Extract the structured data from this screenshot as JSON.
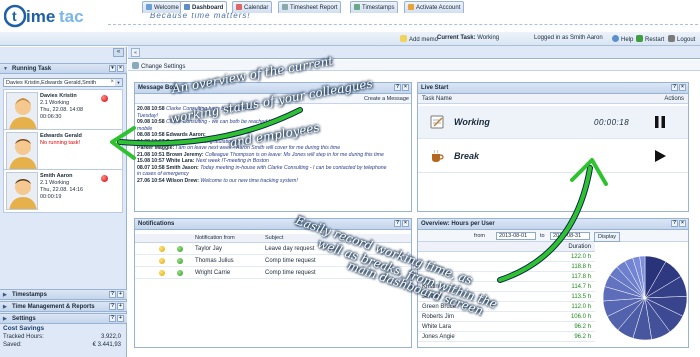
{
  "brand": {
    "logo_text": "timetac",
    "tagline": "Because time matters!",
    "accent_color": "#1f5fa8",
    "running_dot_color": "#d40000"
  },
  "toolbar": {
    "add_memo": "Add memo",
    "current_task_label": "Current Task:",
    "current_task_value": "Working",
    "logged_in": "Logged in as Smith Aaron",
    "help": "Help",
    "restart": "Restart",
    "logout": "Logout"
  },
  "left_panel": {
    "running_task_title": "Running Task",
    "filter_value": "Davies Kristin,Edwards Gerald,Smith",
    "users": [
      {
        "name": "Davies Kristin",
        "task": "2.1 Working",
        "date": "Thu, 22.08. 14:08",
        "duration": "00:06:30",
        "running": true
      },
      {
        "name": "Edwards Gerald",
        "task": "No running task!",
        "date": "",
        "duration": "",
        "running": false
      },
      {
        "name": "Smith Aaron",
        "task": "2.1 Working",
        "date": "Thu, 22.08. 14:16",
        "duration": "00:00:19",
        "running": true
      }
    ],
    "sections": [
      "Timestamps",
      "Time Management & Reports",
      "Settings"
    ],
    "cost_savings": {
      "title": "Cost Savings",
      "tracked_label": "Tracked Hours:",
      "tracked_value": "3.922,0",
      "saved_label": "Saved:",
      "saved_value": "€ 3.441,93"
    }
  },
  "tabs": [
    "Welcome",
    "Dashboard",
    "Calendar",
    "Timesheet Report",
    "Timestamps",
    "Activate Account"
  ],
  "active_tab": "Dashboard",
  "change_settings": "Change Settings",
  "message_box": {
    "title": "Message Box",
    "create_label": "Create a Message",
    "messages": [
      {
        "date": "20.08 10:58",
        "author": "",
        "text": "Clarke Consulting have been moved to"
      },
      {
        "date": "",
        "author": "",
        "text": "Tuesday!"
      },
      {
        "date": "09.08 10:58",
        "author": "",
        "text": "Clarke Consulting - we can both be reached by"
      },
      {
        "date": "",
        "author": "",
        "text": "mobile"
      },
      {
        "date": "08.08 10:58",
        "author": "Edwards Aaron:",
        "text": ""
      },
      {
        "date": "04.08 10:57",
        "author": "Smith Jason:",
        "text": "Congratulations!"
      },
      {
        "date": "",
        "author": "Parker Maggie:",
        "text": "I am on leave next week - Aaron Smith will cover for me during this time"
      },
      {
        "date": "",
        "author": "",
        "text": "Colleague Thompson is on leave: Ms Jones will step in for me during this time"
      },
      {
        "date": "21.08 10:51",
        "author": "Brown Jeremy:",
        "text": "Colleague Thompson is on leave: Ms Jones will step in for me during this time"
      },
      {
        "date": "15.08 10:57",
        "author": "White Lara:",
        "text": "Next week IT-meeting in Boston"
      },
      {
        "date": "08.07 10:58",
        "author": "Smith Jason:",
        "text": "Today meeting in-house with Clarke Consulting - I can be contacted by telephone"
      },
      {
        "date": "",
        "author": "",
        "text": "in cases of emergency"
      },
      {
        "date": "27.06 10:54",
        "author": "Wilson Drew:",
        "text": "Welcome to our new time tracking system!"
      }
    ]
  },
  "live_start": {
    "title": "Live Start",
    "col_task": "Task Name",
    "col_actions": "Actions",
    "rows": [
      {
        "label": "Working",
        "time": "00:00:18",
        "action": "pause"
      },
      {
        "label": "Break",
        "time": "",
        "action": "play"
      }
    ]
  },
  "notifications": {
    "title": "Notifications",
    "col_from": "Notification from",
    "col_subject": "Subject",
    "rows": [
      {
        "from": "Taylor Jay",
        "subject": "Leave day request"
      },
      {
        "from": "Thomas Julius",
        "subject": "Comp time request"
      },
      {
        "from": "Wright Carrie",
        "subject": "Comp time request"
      }
    ]
  },
  "overview": {
    "title": "Overview: Hours per User",
    "from_label": "from",
    "from_date": "2013-08-01",
    "to_label": "to",
    "to_date": "2013-08-31",
    "display_label": "Display",
    "col_duration": "Duration",
    "rows": [
      {
        "name": "",
        "hours": "122.0 h"
      },
      {
        "name": "",
        "hours": "118.8 h"
      },
      {
        "name": "",
        "hours": "117.8 h"
      },
      {
        "name": "Kristin",
        "hours": "114.7 h"
      },
      {
        "name": "Jeremy",
        "hours": "113.5 h"
      },
      {
        "name": "Green Bruce",
        "hours": "112.0 h"
      },
      {
        "name": "Roberts Jim",
        "hours": "106.0 h"
      },
      {
        "name": "White Lara",
        "hours": "96.2 h"
      },
      {
        "name": "Jones Angie",
        "hours": "96.2 h"
      }
    ]
  },
  "annotations": {
    "colleagues_line1": "An overview of the current",
    "colleagues_line2": "working status of your colleagues",
    "colleagues_line3": "and employees",
    "breaks_line1": "Easily record working time, as",
    "breaks_line2": "well as breaks, from within the",
    "breaks_line3": "main dashboard screen"
  }
}
